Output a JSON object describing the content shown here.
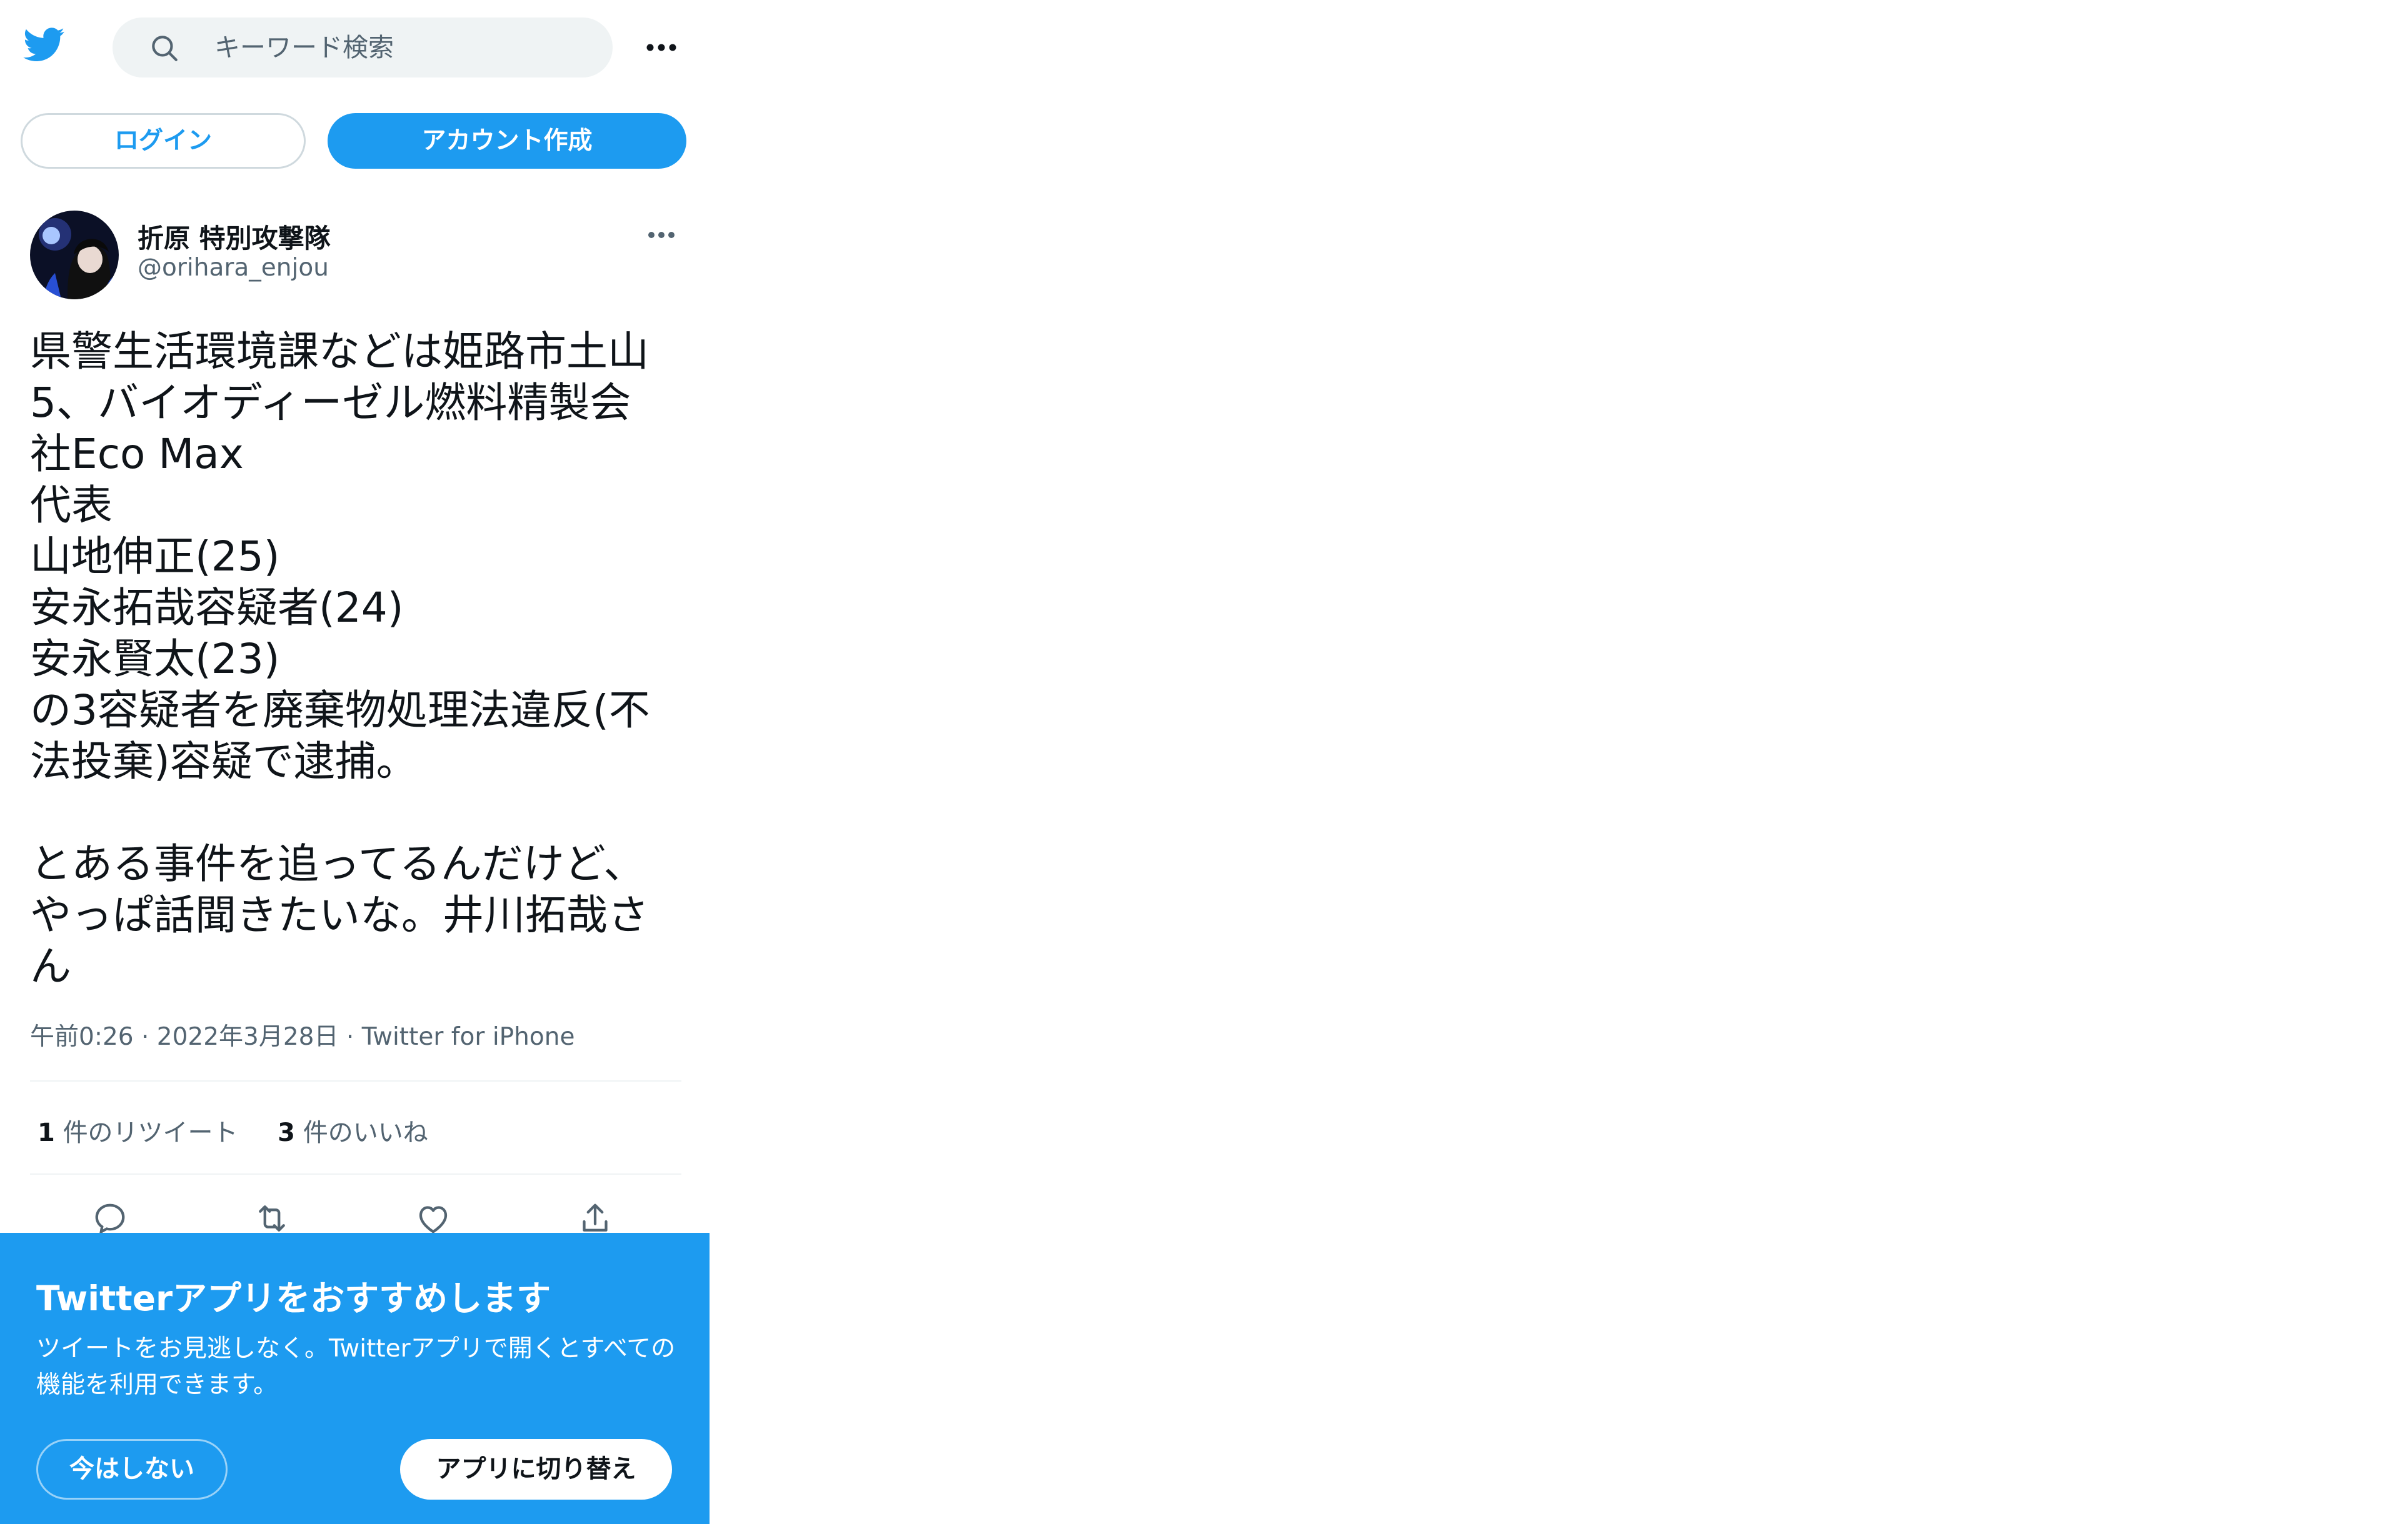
{
  "colors": {
    "accent": "#1d9bf0",
    "text": "#0f1419",
    "muted": "#536471"
  },
  "header": {
    "logo_icon": "twitter-bird-icon",
    "search_placeholder": "キーワード検索",
    "more_icon": "more-horizontal-icon"
  },
  "auth": {
    "login_label": "ログイン",
    "signup_label": "アカウント作成"
  },
  "tweet": {
    "display_name": "折原 特別攻撃隊",
    "handle": "@orihara_enjou",
    "text": "県警生活環境課などは姫路市土山\n5、バイオディーゼル燃料精製会\n社Eco Max\n代表\n山地伸正(25)\n安永拓哉容疑者(24)\n安永賢太(23)\nの3容疑者を廃棄物処理法違反(不\n法投棄)容疑で逮捕。\n\nとある事件を追ってるんだけど、\nやっぱ話聞きたいな。井川拓哉さ\nん",
    "time": "午前0:26",
    "date": "2022年3月28日",
    "source": "Twitter for iPhone",
    "retweet_count": "1",
    "retweet_label": "件のリツイート",
    "like_count": "3",
    "like_label": "件のいいね",
    "actions": [
      "reply-icon",
      "retweet-icon",
      "like-icon",
      "share-icon"
    ]
  },
  "banner": {
    "title": "Twitterアプリをおすすめします",
    "body": "ツイートをお見逃しなく。Twitterアプリで開くとすべての機能を利用できます。",
    "dismiss_label": "今はしない",
    "switch_label": "アプリに切り替え"
  }
}
